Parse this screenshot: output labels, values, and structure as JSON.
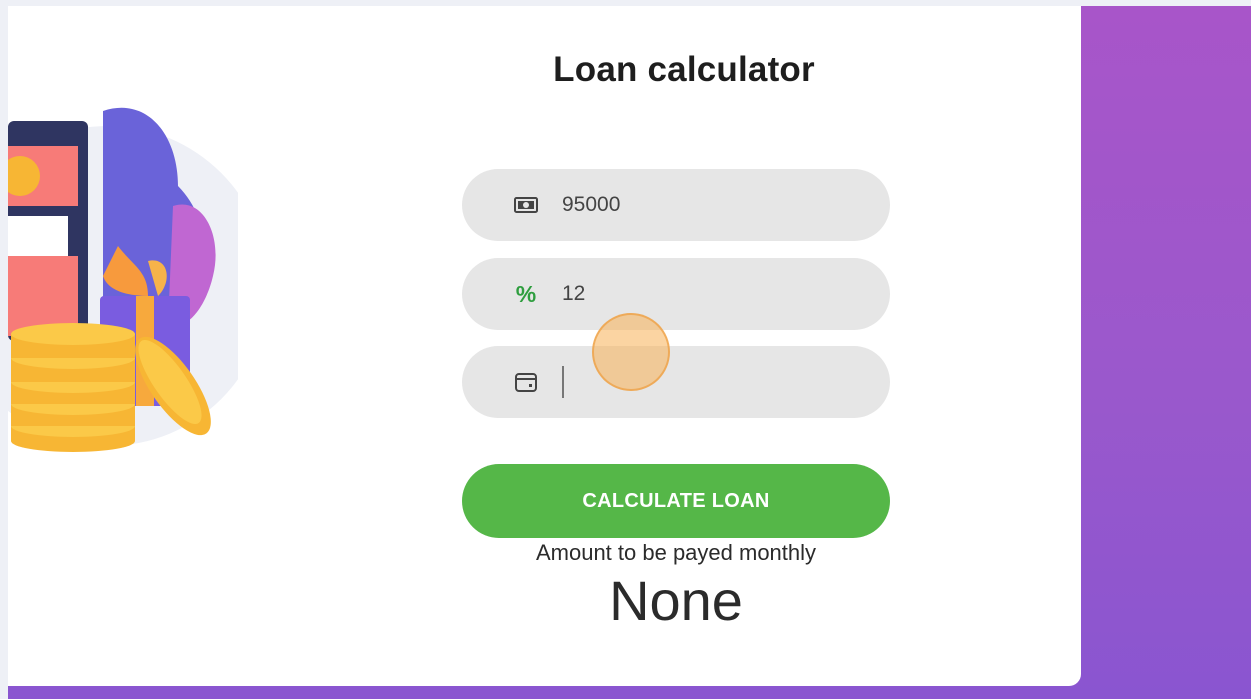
{
  "card": {
    "title": "Loan calculator"
  },
  "form": {
    "amount": {
      "icon": "money-bill-icon",
      "value": "95000"
    },
    "interest": {
      "icon": "percent-icon",
      "symbol": "%",
      "value": "12"
    },
    "duration": {
      "icon": "calendar-icon",
      "value": ""
    },
    "submit_label": "CALCULATE LOAN"
  },
  "result": {
    "label": "Amount to be payed monthly",
    "value": "None"
  },
  "colors": {
    "accent_green": "#55b748",
    "background_purple": "#a855c9",
    "field_gray": "#e6e6e6"
  }
}
